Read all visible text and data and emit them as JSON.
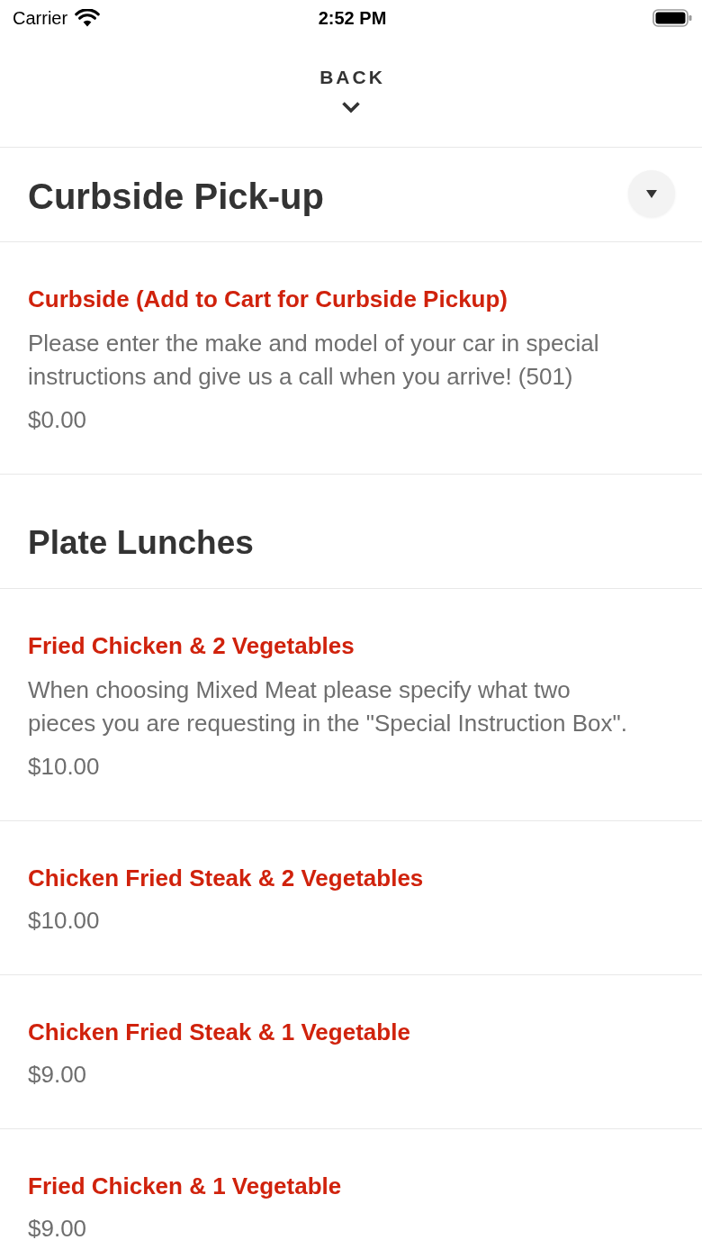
{
  "status_bar": {
    "carrier": "Carrier",
    "time": "2:52 PM"
  },
  "nav": {
    "back_label": "BACK"
  },
  "category_bar": {
    "title": "Curbside Pick-up"
  },
  "sections": [
    {
      "items": [
        {
          "title": "Curbside (Add to Cart for Curbside Pickup)",
          "description": "Please enter the make and model of your car in special instructions and give us a call when you arrive! (501)",
          "price": "$0.00"
        }
      ]
    },
    {
      "title": "Plate Lunches",
      "items": [
        {
          "title": "Fried Chicken & 2 Vegetables",
          "description": "When choosing Mixed Meat please specify what two pieces you are requesting in the \"Special Instruction Box\".",
          "price": "$10.00"
        },
        {
          "title": "Chicken Fried Steak & 2 Vegetables",
          "price": "$10.00"
        },
        {
          "title": "Chicken Fried Steak & 1 Vegetable",
          "price": "$9.00"
        },
        {
          "title": "Fried Chicken & 1 Vegetable",
          "price": "$9.00"
        }
      ]
    }
  ]
}
